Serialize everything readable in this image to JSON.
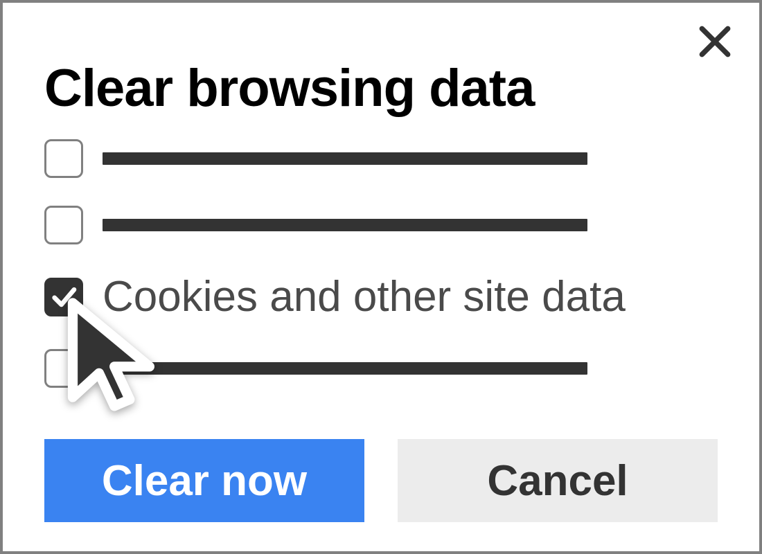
{
  "dialog": {
    "title": "Clear browsing data",
    "options": [
      {
        "label": "",
        "checked": false
      },
      {
        "label": "",
        "checked": false
      },
      {
        "label": "Cookies and other site data",
        "checked": true
      },
      {
        "label": "",
        "checked": false
      }
    ],
    "primary_label": "Clear now",
    "secondary_label": "Cancel"
  }
}
